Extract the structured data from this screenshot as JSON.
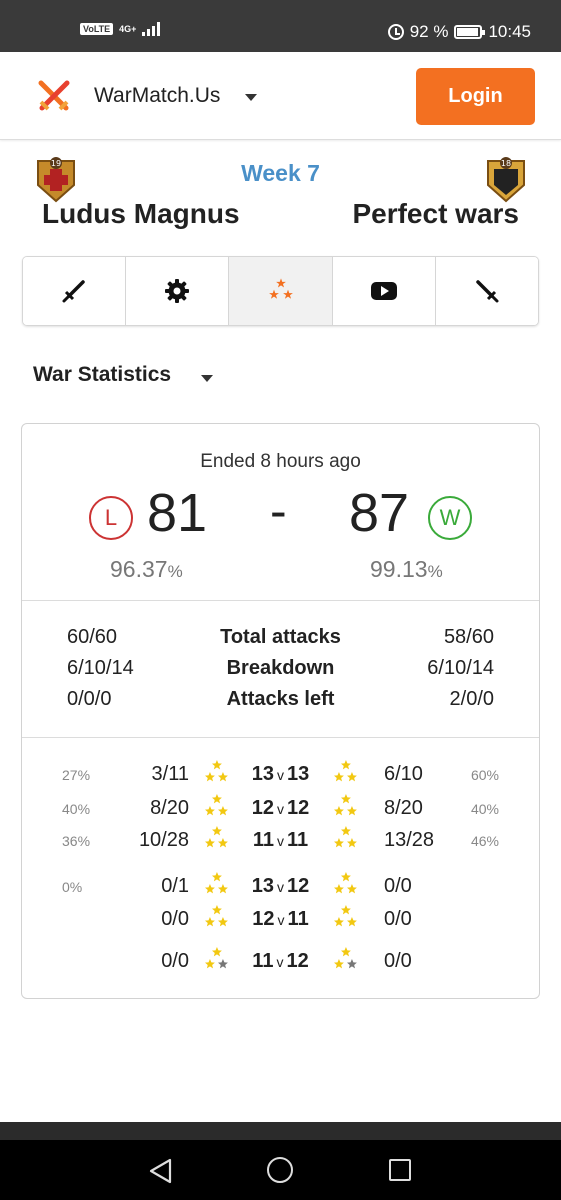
{
  "status_bar": {
    "volte": "VoLTE",
    "network": "4G+",
    "battery": "92 %",
    "battery_level": 0.92,
    "time": "10:45"
  },
  "navbar": {
    "brand": "WarMatch.Us",
    "login_label": "Login"
  },
  "match": {
    "week": "Week 7",
    "left_clan": "Ludus Magnus",
    "right_clan": "Perfect wars",
    "left_badge_level": "19",
    "right_badge_level": "18"
  },
  "tabs": [
    {
      "icon": "sword-icon",
      "active": false
    },
    {
      "icon": "gear-icon",
      "active": false
    },
    {
      "icon": "stars-icon",
      "active": true
    },
    {
      "icon": "youtube-icon",
      "active": false
    },
    {
      "icon": "sword-reverse-icon",
      "active": false
    }
  ],
  "section": {
    "title": "War Statistics"
  },
  "summary": {
    "ended": "Ended 8 hours ago",
    "left_result": "L",
    "right_result": "W",
    "left_score": "81",
    "right_score": "87",
    "separator": "-",
    "left_pct": "96.37",
    "right_pct": "99.13",
    "pct_unit": "%"
  },
  "stats": [
    {
      "left": "60/60",
      "label": "Total attacks",
      "right": "58/60"
    },
    {
      "left": "6/10/14",
      "label": "Breakdown",
      "right": "6/10/14"
    },
    {
      "left": "0/0/0",
      "label": "Attacks left",
      "right": "2/0/0"
    }
  ],
  "townhall_rows": [
    {
      "left_pct": "27",
      "left": "3/11",
      "th_left": "13",
      "vs": "v",
      "th_right": "13",
      "right": "6/10",
      "right_pct": "60",
      "stars": 3
    },
    {
      "left_pct": "40",
      "left": "8/20",
      "th_left": "12",
      "vs": "v",
      "th_right": "12",
      "right": "8/20",
      "right_pct": "40",
      "stars": 3
    },
    {
      "left_pct": "36",
      "left": "10/28",
      "th_left": "11",
      "vs": "v",
      "th_right": "11",
      "right": "13/28",
      "right_pct": "46",
      "stars": 3
    },
    {
      "left_pct": "0",
      "left": "0/1",
      "th_left": "13",
      "vs": "v",
      "th_right": "12",
      "right": "0/0",
      "right_pct": "",
      "stars": 3
    },
    {
      "left_pct": "",
      "left": "0/0",
      "th_left": "12",
      "vs": "v",
      "th_right": "11",
      "right": "0/0",
      "right_pct": "",
      "stars": 3
    },
    {
      "left_pct": "",
      "left": "0/0",
      "th_left": "11",
      "vs": "v",
      "th_right": "12",
      "right": "0/0",
      "right_pct": "",
      "stars": 2
    }
  ],
  "colors": {
    "brand_orange": "#f37021",
    "week_blue": "#4a90c8",
    "loss_red": "#cc3333",
    "win_green": "#3aaa3a",
    "star_gold": "#f2c811",
    "star_grey": "#777777"
  }
}
